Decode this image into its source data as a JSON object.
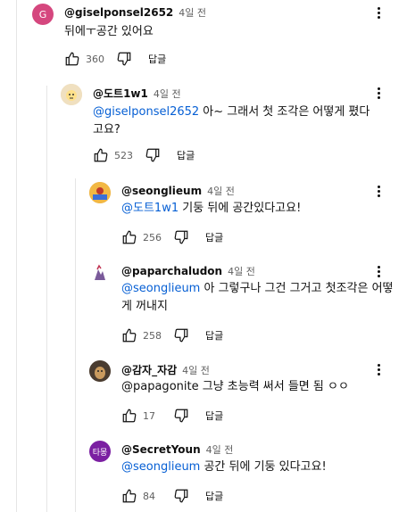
{
  "comments": [
    {
      "author": "@giselponsel2652",
      "time": "4일 전",
      "avatar_letter": "G",
      "avatar_color": "#d5477e",
      "text": "뒤에ㅜ공간 있어요",
      "likes": "360",
      "reply_label": "답글"
    },
    {
      "author": "@도트1w1",
      "time": "4일 전",
      "avatar_color": "#e8d7b4",
      "mention": "@giselponsel2652",
      "text": " 아~ 그래서 첫 조각은 어떻게 폈다고요?",
      "likes": "523",
      "reply_label": "답글"
    },
    {
      "author": "@seonglieum",
      "time": "4일 전",
      "avatar_color": "#e2a23b",
      "mention": "@도트1w1",
      "text": " 기둥 뒤에 공간있다고요!",
      "likes": "256",
      "reply_label": "답글"
    },
    {
      "author": "@paparchaludon",
      "time": "4일 전",
      "avatar_color": "#ffffff",
      "mention": "@seonglieum",
      "text": " 아 그렇구나 그건 그거고 첫조각은 어떻게 꺼내지",
      "likes": "258",
      "reply_label": "답글"
    },
    {
      "author": "@감자_자감",
      "time": "4일 전",
      "avatar_color": "#5a4a3c",
      "text": "@papagonite 그냥 초능력 써서 들면 됨 ㅇㅇ",
      "likes": "17",
      "reply_label": "답글"
    },
    {
      "author": "@SecretYoun",
      "time": "4일 전",
      "avatar_letter": "타몽",
      "avatar_color": "#7b1fa2",
      "mention": "@seonglieum",
      "text": " 공간 뒤에 기둥 있다고요!",
      "likes": "84",
      "reply_label": "답글"
    }
  ],
  "icons": {
    "like": "thumbs-up-icon",
    "dislike": "thumbs-down-icon",
    "menu": "more-vertical-icon"
  }
}
